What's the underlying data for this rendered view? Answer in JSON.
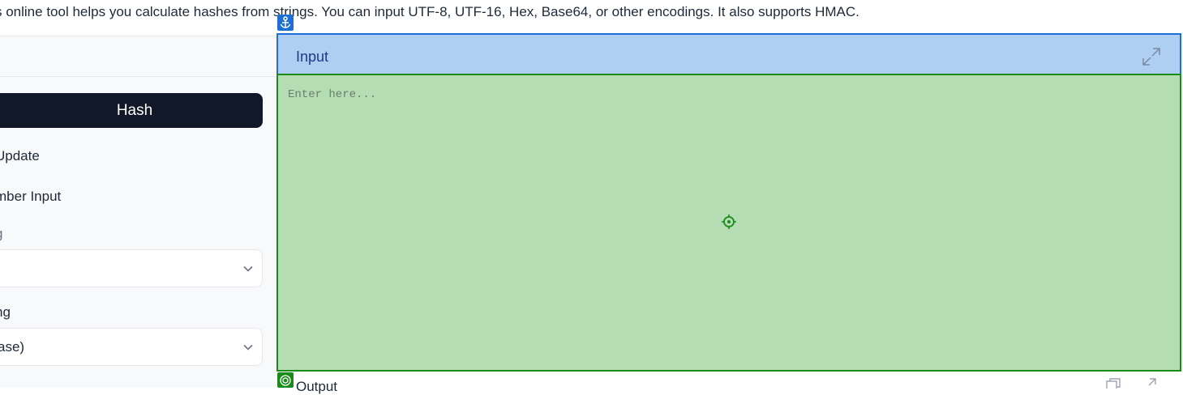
{
  "description": "s online tool helps you calculate hashes from strings. You can input UTF-8, UTF-16, Hex, Base64, or other encodings. It also supports HMAC.",
  "left": {
    "hash_button": "Hash",
    "auto_update": "Update",
    "remember_input": "mber Input",
    "input_encoding_label": "g",
    "input_encoding_value": "",
    "output_encoding_label": "ng",
    "output_encoding_value": "ase)"
  },
  "input_panel": {
    "title": "Input",
    "placeholder": "Enter here..."
  },
  "output_panel": {
    "title": "Output"
  },
  "colors": {
    "hash_button_bg": "#111827",
    "input_header_bg": "#aecff2",
    "input_area_bg": "#b4ddb4"
  },
  "icons": {
    "expand": "expand-icon",
    "anchor": "anchor-icon",
    "target": "target-icon",
    "crosshair": "crosshair-icon",
    "chevron": "chevron-down-icon",
    "copy": "copy-icon"
  }
}
